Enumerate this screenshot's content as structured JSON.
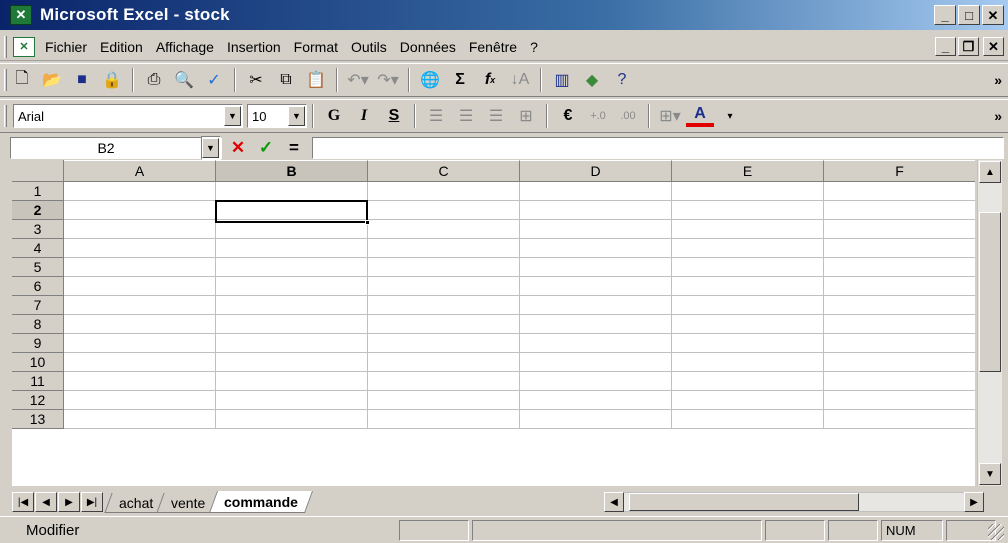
{
  "window": {
    "title": "Microsoft Excel - stock",
    "app_icon": "excel-logo-icon",
    "controls": [
      "minimize-icon",
      "maximize-icon",
      "close-icon"
    ]
  },
  "menubar": {
    "items": [
      "Fichier",
      "Edition",
      "Affichage",
      "Insertion",
      "Format",
      "Outils",
      "Données",
      "Fenêtre",
      "?"
    ]
  },
  "standard_toolbar": {
    "icons": [
      "new-icon",
      "open-icon",
      "save-icon",
      "permission-icon",
      "print-icon",
      "print-preview-icon",
      "spelling-icon",
      "cut-icon",
      "copy-icon",
      "paste-icon",
      "undo-icon",
      "redo-icon",
      "hyperlink-icon",
      "autosum-icon",
      "function-icon",
      "sort-ascending-icon",
      "chart-wizard-icon",
      "drawing-icon",
      "help-icon"
    ]
  },
  "formatting_toolbar": {
    "font": "Arial",
    "size": "10",
    "bold": "G",
    "italic": "I",
    "underline": "S",
    "currency": "€"
  },
  "formula_bar": {
    "name_box": "B2",
    "value": ""
  },
  "grid": {
    "columns": [
      "A",
      "B",
      "C",
      "D",
      "E",
      "F"
    ],
    "rows": [
      "1",
      "2",
      "3",
      "4",
      "5",
      "6",
      "7",
      "8",
      "9",
      "10",
      "11",
      "12",
      "13"
    ],
    "active_cell": "B2",
    "active_column": "B",
    "active_row": "2"
  },
  "sheets": {
    "tabs": [
      "achat",
      "vente",
      "commande"
    ],
    "active": "commande"
  },
  "statusbar": {
    "mode": "Modifier",
    "num_lock": "NUM"
  }
}
